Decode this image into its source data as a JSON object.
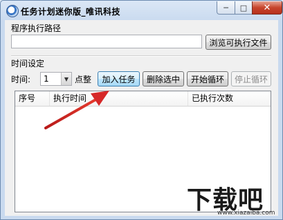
{
  "window": {
    "title": "任务计划迷你版_唯讯科技",
    "minimize_glyph": "─",
    "maximize_glyph": "□",
    "close_glyph": "✕"
  },
  "path_section": {
    "label": "程序执行路径",
    "input_value": "",
    "browse_button": "浏览可执行文件"
  },
  "time_section": {
    "label": "时间设定",
    "time_label": "时间:",
    "hour_value": "1",
    "unit_label": "点整",
    "add_button": "加入任务",
    "delete_button": "删除选中",
    "start_button": "开始循环",
    "stop_button": "停止循环"
  },
  "table": {
    "columns": [
      "序号",
      "执行时间",
      "",
      "已执行次数"
    ],
    "rows": []
  },
  "watermark": {
    "text": "下载吧",
    "url": "www.xiazaiba.com"
  },
  "colors": {
    "arrow": "#d62828",
    "focused_button": "#bee6fd"
  }
}
